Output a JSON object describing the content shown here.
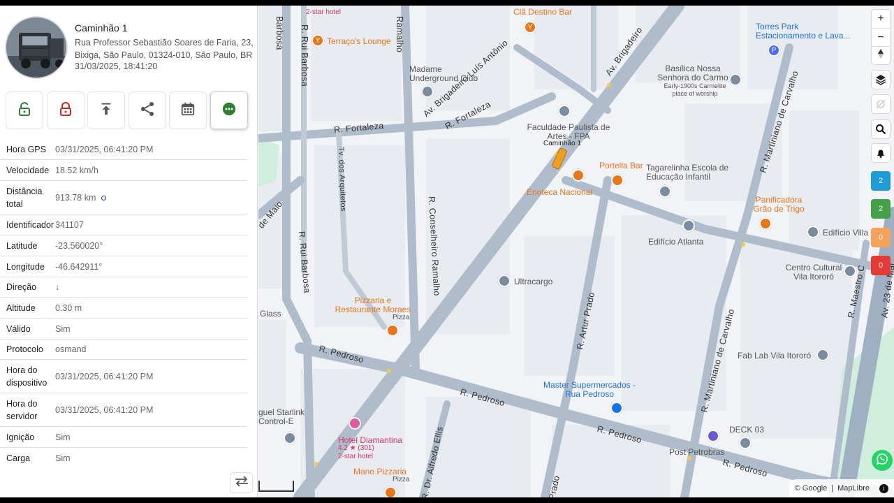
{
  "device": {
    "name": "Caminhão 1",
    "address": "Rua Professor Sebastião Soares de Faria, 23, Bixiga, São Paulo, 01324-010, São Paulo, BR",
    "timestamp": "31/03/2025, 18:41:20"
  },
  "actions": [
    {
      "name": "unlock-icon",
      "color": "#2e7d32"
    },
    {
      "name": "lock-icon",
      "color": "#c62828"
    },
    {
      "name": "upload-icon",
      "color": "#555555"
    },
    {
      "name": "share-icon",
      "color": "#555555"
    },
    {
      "name": "calendar-icon",
      "color": "#555555"
    },
    {
      "name": "more-icon",
      "color": "#2e7d32"
    }
  ],
  "attributes": [
    {
      "key": "Hora GPS",
      "value": "03/31/2025, 06:41:20 PM"
    },
    {
      "key": "Velocidade",
      "value": "18.52 km/h"
    },
    {
      "key": "Distância total",
      "value": "913.78 km"
    },
    {
      "key": "Identificador",
      "value": "341107"
    },
    {
      "key": "Latitude",
      "value": "-23.560020°"
    },
    {
      "key": "Longitude",
      "value": "-46.642911°"
    },
    {
      "key": "Direção",
      "value": "↓"
    },
    {
      "key": "Altitude",
      "value": "0.30 m"
    },
    {
      "key": "Válido",
      "value": "Sim"
    },
    {
      "key": "Protocolo",
      "value": "osmand"
    },
    {
      "key": "Hora do dispositivo",
      "value": "03/31/2025, 06:41:20 PM"
    },
    {
      "key": "Hora do servidor",
      "value": "03/31/2025, 06:41:20 PM"
    },
    {
      "key": "Ignição",
      "value": "Sim"
    },
    {
      "key": "Carga",
      "value": "Sim"
    }
  ],
  "map": {
    "streets": [
      {
        "text": "Av. Brigadeiro Luís Antônio"
      },
      {
        "text": "Av. Brigadeiro"
      },
      {
        "text": "R. Fortaleza"
      },
      {
        "text": "R. Fortaleza"
      },
      {
        "text": "R. Conselheiro Ramalho"
      },
      {
        "text": "R. Rui Barbosa"
      },
      {
        "text": "R. Rui Barbosa"
      },
      {
        "text": "R. Pedroso"
      },
      {
        "text": "R. Pedroso"
      },
      {
        "text": "R. Pedroso"
      },
      {
        "text": "R. Pedroso"
      },
      {
        "text": "R. Artur Prado"
      },
      {
        "text": "R. Martiniano de Carvalho"
      },
      {
        "text": "R. Martiniano de Carvalho"
      },
      {
        "text": "Tv. dos Arquitetos"
      },
      {
        "text": "R. Dr. Alfredo Ellis"
      },
      {
        "text": "R. Maestro C"
      },
      {
        "text": "Av. 23 de Mai"
      },
      {
        "text": "Ramalho"
      },
      {
        "text": "Barbosa"
      },
      {
        "text": "de Maio"
      },
      {
        "text": "Prado"
      }
    ],
    "pois": [
      {
        "text": "Clã Destino Bar",
        "kind": "o"
      },
      {
        "text": "Terraço's Lounge",
        "kind": "o"
      },
      {
        "text": "Madame Underground Club",
        "kind": "g"
      },
      {
        "text": "Faculdade Paulista de Artes - FPA",
        "kind": "g"
      },
      {
        "text": "Portella Bar",
        "kind": "o"
      },
      {
        "text": "Enoteca Nacional",
        "kind": "o"
      },
      {
        "text": "Tagarelinha Escola de Educação Infantil",
        "kind": "g"
      },
      {
        "text": "Basílica Nossa Senhora do Carmo",
        "kind": "g"
      },
      {
        "text": "Early-1900s Carmelite place of worship",
        "kind": "g"
      },
      {
        "text": "Torres Park Estacionamento e Lava...",
        "kind": "b"
      },
      {
        "text": "Panificadora Grão de Trigo",
        "kind": "o"
      },
      {
        "text": "Edifício Villa",
        "kind": "g"
      },
      {
        "text": "Edifício Atlanta",
        "kind": "g"
      },
      {
        "text": "Centro Cultural Vila Itororó",
        "kind": "g"
      },
      {
        "text": "Ultracargo",
        "kind": "g"
      },
      {
        "text": "Pizzaria e Restaurante Moraes",
        "kind": "o"
      },
      {
        "text": "Pizza",
        "kind": "g"
      },
      {
        "text": "Glass",
        "kind": "g"
      },
      {
        "text": "Fab Lab Vila Itororó",
        "kind": "g"
      },
      {
        "text": "Master Supermercados - Rua Pedroso",
        "kind": "b"
      },
      {
        "text": "DECK 03",
        "kind": "g"
      },
      {
        "text": "Post Petrobras",
        "kind": "g"
      },
      {
        "text": "Hotel Diamantina",
        "kind": "p"
      },
      {
        "text": "4.2 ★ (301)",
        "kind": "p"
      },
      {
        "text": "2-star hotel",
        "kind": "p"
      },
      {
        "text": "Mano Pizzaria",
        "kind": "o"
      },
      {
        "text": "Pizza",
        "kind": "g"
      },
      {
        "text": "guel Starlink Control-E",
        "kind": "g"
      },
      {
        "text": "2-star hotel",
        "kind": "p"
      }
    ],
    "vehicle_label": "Caminhão 1",
    "controls": {
      "zoom_in": "+",
      "zoom_out": "−"
    },
    "badges": [
      {
        "value": "2",
        "color": "#1e9bd7"
      },
      {
        "value": "2",
        "color": "#43a047"
      },
      {
        "value": "0",
        "color": "#f4a259"
      },
      {
        "value": "0",
        "color": "#e53935"
      }
    ],
    "attribution": {
      "google": "© Google",
      "sep": "|",
      "maplibre": "MapLibre"
    }
  },
  "colors": {
    "road": "#aebccb",
    "block": "#e8ebef",
    "park": "#cfeedd"
  }
}
